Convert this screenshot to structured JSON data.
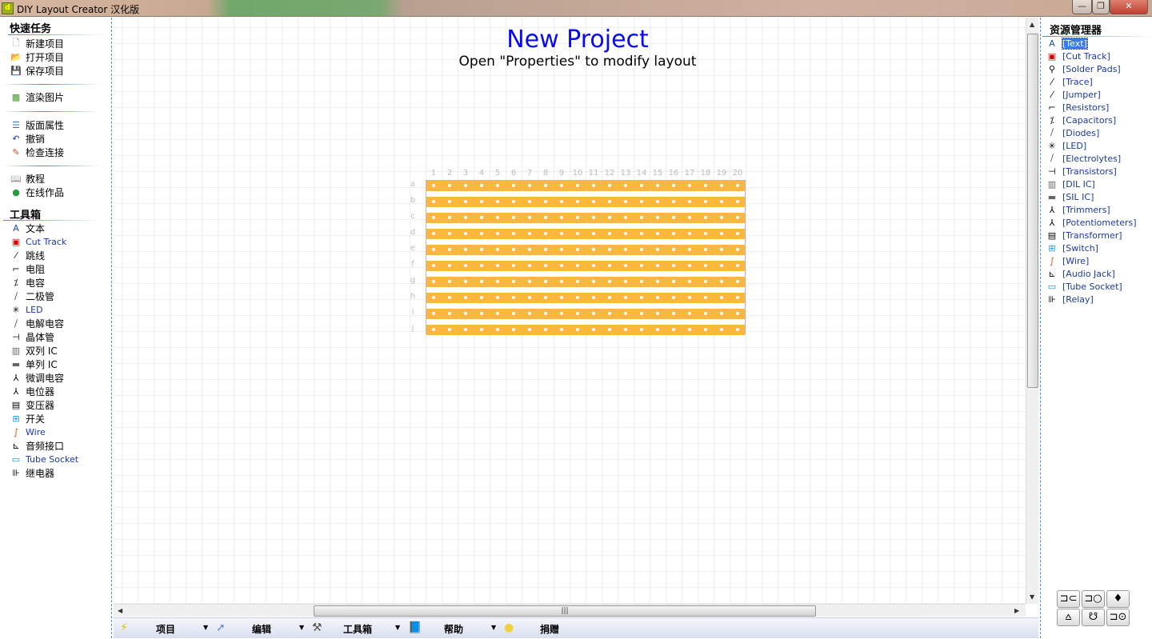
{
  "window": {
    "title": "DIY Layout Creator 汉化版",
    "minimize": "—",
    "maximize": "❐",
    "close": "✕"
  },
  "left_panel": {
    "quick_tasks": {
      "heading": "快速任务",
      "items": [
        {
          "label": "新建项目",
          "icon": "new-file-icon"
        },
        {
          "label": "打开项目",
          "icon": "open-folder-icon"
        },
        {
          "label": "保存项目",
          "icon": "save-icon"
        },
        {
          "label": "渲染图片",
          "icon": "render-image-icon"
        },
        {
          "label": "版面属性",
          "icon": "properties-icon"
        },
        {
          "label": "撤销",
          "icon": "undo-icon"
        },
        {
          "label": "检查连接",
          "icon": "check-connections-icon"
        },
        {
          "label": "教程",
          "icon": "tutorial-icon"
        },
        {
          "label": "在线作品",
          "icon": "globe-icon"
        }
      ]
    },
    "toolbox": {
      "heading": "工具箱",
      "items": [
        {
          "label": "文本",
          "icon": "text-icon"
        },
        {
          "label": "Cut Track",
          "icon": "cut-track-icon"
        },
        {
          "label": "跳线",
          "icon": "jumper-icon"
        },
        {
          "label": "电阻",
          "icon": "resistor-icon"
        },
        {
          "label": "电容",
          "icon": "capacitor-icon"
        },
        {
          "label": "二极管",
          "icon": "diode-icon"
        },
        {
          "label": "LED",
          "icon": "led-icon"
        },
        {
          "label": "电解电容",
          "icon": "electrolytic-icon"
        },
        {
          "label": "晶体管",
          "icon": "transistor-icon"
        },
        {
          "label": "双列 IC",
          "icon": "dil-ic-icon"
        },
        {
          "label": "单列 IC",
          "icon": "sil-ic-icon"
        },
        {
          "label": "微调电容",
          "icon": "trimmer-icon"
        },
        {
          "label": "电位器",
          "icon": "potentiometer-icon"
        },
        {
          "label": "变压器",
          "icon": "transformer-icon"
        },
        {
          "label": "开关",
          "icon": "switch-icon"
        },
        {
          "label": "Wire",
          "icon": "wire-icon"
        },
        {
          "label": "音频接口",
          "icon": "audio-jack-icon"
        },
        {
          "label": "Tube Socket",
          "icon": "tube-socket-icon"
        },
        {
          "label": "继电器",
          "icon": "relay-icon"
        }
      ]
    }
  },
  "canvas": {
    "title": "New Project",
    "subtitle": "Open \"Properties\" to modify layout",
    "board": {
      "columns": [
        "1",
        "2",
        "3",
        "4",
        "5",
        "6",
        "7",
        "8",
        "9",
        "10",
        "11",
        "12",
        "13",
        "14",
        "15",
        "16",
        "17",
        "18",
        "19",
        "20"
      ],
      "rows": [
        "a",
        "b",
        "c",
        "d",
        "e",
        "f",
        "g",
        "h",
        "i",
        "j"
      ],
      "strip_color": "#fdb73f"
    }
  },
  "bottom_toolbar": [
    {
      "label": "项目",
      "icon": "lightning-icon"
    },
    {
      "label": "编辑",
      "icon": "cursor-icon"
    },
    {
      "label": "工具箱",
      "icon": "hammer-icon"
    },
    {
      "label": "帮助",
      "icon": "help-book-icon"
    },
    {
      "label": "捐赠",
      "icon": "coin-icon"
    }
  ],
  "right_panel": {
    "heading": "资源管理器",
    "selected": "[Text]",
    "items": [
      {
        "label": "[Text]",
        "icon": "text-icon"
      },
      {
        "label": "[Cut Track]",
        "icon": "cut-track-icon"
      },
      {
        "label": "[Solder Pads]",
        "icon": "solder-pad-icon"
      },
      {
        "label": "[Trace]",
        "icon": "trace-icon"
      },
      {
        "label": "[Jumper]",
        "icon": "jumper-icon"
      },
      {
        "label": "[Resistors]",
        "icon": "resistor-icon"
      },
      {
        "label": "[Capacitors]",
        "icon": "capacitor-icon"
      },
      {
        "label": "[Diodes]",
        "icon": "diode-icon"
      },
      {
        "label": "[LED]",
        "icon": "led-icon"
      },
      {
        "label": "[Electrolytes]",
        "icon": "electrolytic-icon"
      },
      {
        "label": "[Transistors]",
        "icon": "transistor-icon"
      },
      {
        "label": "[DIL IC]",
        "icon": "dil-ic-icon"
      },
      {
        "label": "[SIL IC]",
        "icon": "sil-ic-icon"
      },
      {
        "label": "[Trimmers]",
        "icon": "trimmer-icon"
      },
      {
        "label": "[Potentiometers]",
        "icon": "potentiometer-icon"
      },
      {
        "label": "[Transformer]",
        "icon": "transformer-icon"
      },
      {
        "label": "[Switch]",
        "icon": "switch-icon"
      },
      {
        "label": "[Wire]",
        "icon": "wire-icon"
      },
      {
        "label": "[Audio Jack]",
        "icon": "audio-jack-icon"
      },
      {
        "label": "[Tube Socket]",
        "icon": "tube-socket-icon"
      },
      {
        "label": "[Relay]",
        "icon": "relay-icon"
      }
    ],
    "tool_buttons": [
      "⊐⊂",
      "⊐○",
      "♦",
      "⩟",
      "☋",
      "⊐⊙"
    ]
  }
}
